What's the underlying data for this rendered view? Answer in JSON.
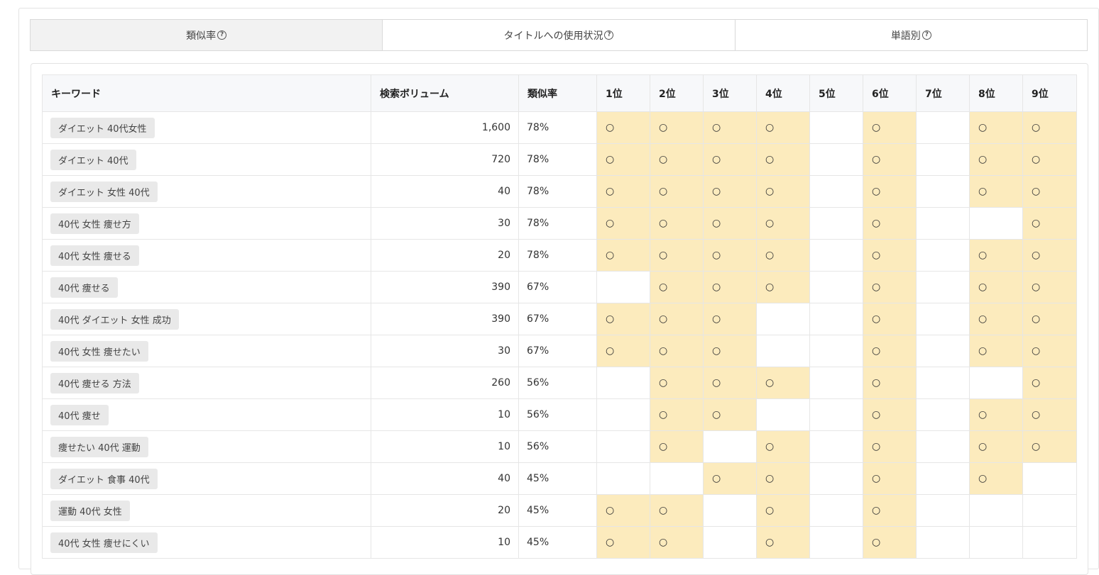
{
  "tabs": [
    {
      "label": "類似率",
      "active": true
    },
    {
      "label": "タイトルへの使用状況",
      "active": false
    },
    {
      "label": "単語別",
      "active": false
    }
  ],
  "help_icon_glyph": "?",
  "table": {
    "headers": {
      "keyword": "キーワード",
      "volume": "検索ボリューム",
      "similarity": "類似率",
      "ranks": [
        "1位",
        "2位",
        "3位",
        "4位",
        "5位",
        "6位",
        "7位",
        "8位",
        "9位"
      ]
    },
    "mark": "○",
    "highlight_color": "#fcebbd",
    "rows": [
      {
        "keyword": "ダイエット 40代女性",
        "volume": "1,600",
        "similarity": "78%",
        "ranks": [
          1,
          1,
          1,
          1,
          0,
          1,
          0,
          1,
          1
        ]
      },
      {
        "keyword": "ダイエット 40代",
        "volume": "720",
        "similarity": "78%",
        "ranks": [
          1,
          1,
          1,
          1,
          0,
          1,
          0,
          1,
          1
        ]
      },
      {
        "keyword": "ダイエット 女性 40代",
        "volume": "40",
        "similarity": "78%",
        "ranks": [
          1,
          1,
          1,
          1,
          0,
          1,
          0,
          1,
          1
        ]
      },
      {
        "keyword": "40代 女性 痩せ方",
        "volume": "30",
        "similarity": "78%",
        "ranks": [
          1,
          1,
          1,
          1,
          0,
          1,
          0,
          0,
          1
        ]
      },
      {
        "keyword": "40代 女性 痩せる",
        "volume": "20",
        "similarity": "78%",
        "ranks": [
          1,
          1,
          1,
          1,
          0,
          1,
          0,
          1,
          1
        ]
      },
      {
        "keyword": "40代 痩せる",
        "volume": "390",
        "similarity": "67%",
        "ranks": [
          0,
          1,
          1,
          1,
          0,
          1,
          0,
          1,
          1
        ]
      },
      {
        "keyword": "40代 ダイエット 女性 成功",
        "volume": "390",
        "similarity": "67%",
        "ranks": [
          1,
          1,
          1,
          0,
          0,
          1,
          0,
          1,
          1
        ]
      },
      {
        "keyword": "40代 女性 痩せたい",
        "volume": "30",
        "similarity": "67%",
        "ranks": [
          1,
          1,
          1,
          0,
          0,
          1,
          0,
          1,
          1
        ]
      },
      {
        "keyword": "40代 痩せる 方法",
        "volume": "260",
        "similarity": "56%",
        "ranks": [
          0,
          1,
          1,
          1,
          0,
          1,
          0,
          0,
          1
        ]
      },
      {
        "keyword": "40代 痩せ",
        "volume": "10",
        "similarity": "56%",
        "ranks": [
          0,
          1,
          1,
          0,
          0,
          1,
          0,
          1,
          1
        ]
      },
      {
        "keyword": "痩せたい 40代 運動",
        "volume": "10",
        "similarity": "56%",
        "ranks": [
          0,
          1,
          0,
          1,
          0,
          1,
          0,
          1,
          1
        ]
      },
      {
        "keyword": "ダイエット 食事 40代",
        "volume": "40",
        "similarity": "45%",
        "ranks": [
          0,
          0,
          1,
          1,
          0,
          1,
          0,
          1,
          0
        ]
      },
      {
        "keyword": "運動 40代 女性",
        "volume": "20",
        "similarity": "45%",
        "ranks": [
          1,
          1,
          0,
          1,
          0,
          1,
          0,
          0,
          0
        ]
      },
      {
        "keyword": "40代 女性 痩せにくい",
        "volume": "10",
        "similarity": "45%",
        "ranks": [
          1,
          1,
          0,
          1,
          0,
          1,
          0,
          0,
          0
        ]
      }
    ]
  }
}
